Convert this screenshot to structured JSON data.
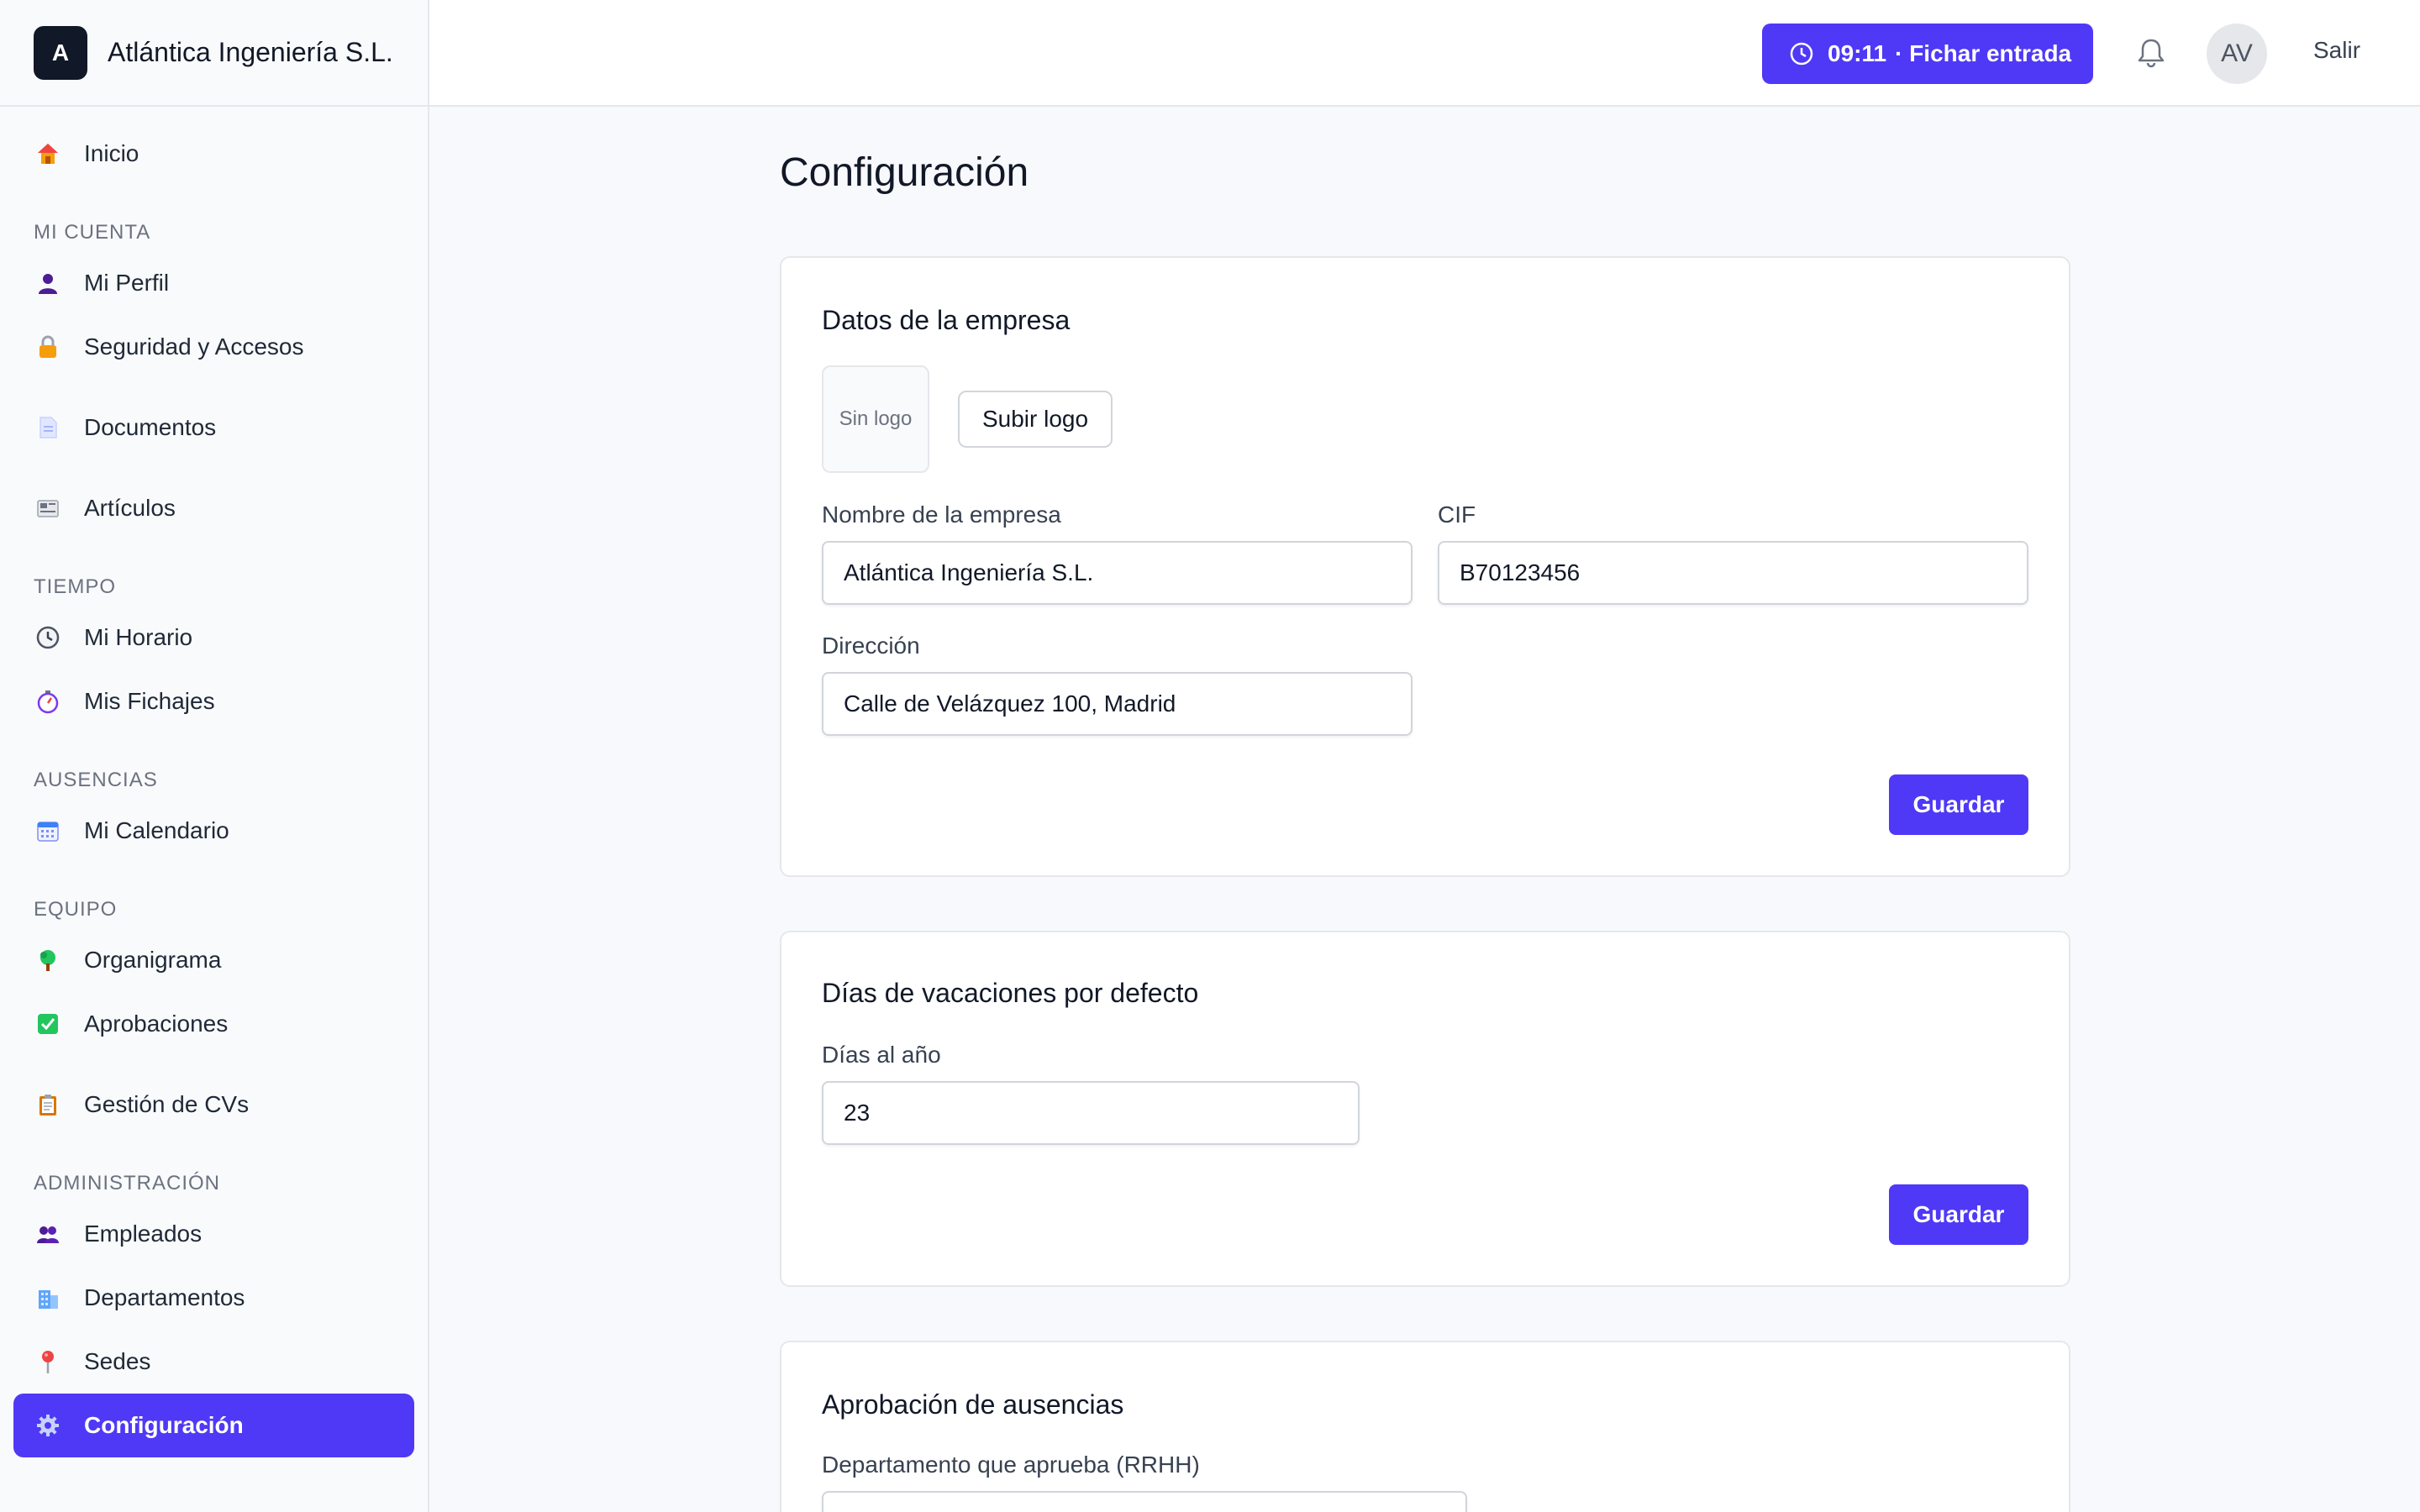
{
  "brand": {
    "logo_letter": "A",
    "name": "Atlántica Ingeniería S.L."
  },
  "sidebar": {
    "inicio": {
      "label": "Inicio",
      "icon": "house-icon"
    },
    "sections": {
      "mi_cuenta": "MI CUENTA",
      "tiempo": "TIEMPO",
      "ausencias": "AUSENCIAS",
      "equipo": "EQUIPO",
      "administracion": "ADMINISTRACIÓN"
    },
    "items": {
      "mi_perfil": {
        "label": "Mi Perfil",
        "icon": "person-icon"
      },
      "seguridad": {
        "label": "Seguridad y Accesos",
        "icon": "lock-icon"
      },
      "documentos": {
        "label": "Documentos",
        "icon": "document-icon"
      },
      "articulos": {
        "label": "Artículos",
        "icon": "newspaper-icon"
      },
      "mi_horario": {
        "label": "Mi Horario",
        "icon": "clock-icon"
      },
      "mis_fichajes": {
        "label": "Mis Fichajes",
        "icon": "stopwatch-icon"
      },
      "mi_calendario": {
        "label": "Mi Calendario",
        "icon": "calendar-icon"
      },
      "organigrama": {
        "label": "Organigrama",
        "icon": "tree-icon"
      },
      "aprobaciones": {
        "label": "Aprobaciones",
        "icon": "checkbox-icon"
      },
      "gestion_cvs": {
        "label": "Gestión de CVs",
        "icon": "clipboard-icon"
      },
      "empleados": {
        "label": "Empleados",
        "icon": "people-icon"
      },
      "departamentos": {
        "label": "Departamentos",
        "icon": "building-icon"
      },
      "sedes": {
        "label": "Sedes",
        "icon": "pin-icon"
      },
      "configuracion": {
        "label": "Configuración",
        "icon": "gear-icon",
        "active": true
      }
    }
  },
  "topbar": {
    "clock_time": "09:11",
    "clock_action": "· Fichar entrada",
    "avatar_initials": "AV",
    "logout_label": "Salir"
  },
  "main": {
    "title": "Configuración",
    "company": {
      "title": "Datos de la empresa",
      "logo_placeholder": "Sin logo",
      "upload_label": "Subir logo",
      "name_label": "Nombre de la empresa",
      "name_value": "Atlántica Ingeniería S.L.",
      "cif_label": "CIF",
      "cif_value": "B70123456",
      "address_label": "Dirección",
      "address_value": "Calle de Velázquez 100, Madrid",
      "save_label": "Guardar"
    },
    "vacation": {
      "title": "Días de vacaciones por defecto",
      "days_label": "Días al año",
      "days_value": "23",
      "save_label": "Guardar"
    },
    "absences": {
      "title": "Aprobación de ausencias",
      "dept_label": "Departamento que aprueba (RRHH)"
    }
  },
  "colors": {
    "accent": "#4f39f6",
    "sidebar_bg": "#f9fafb",
    "page_bg": "#f8f9fc"
  }
}
